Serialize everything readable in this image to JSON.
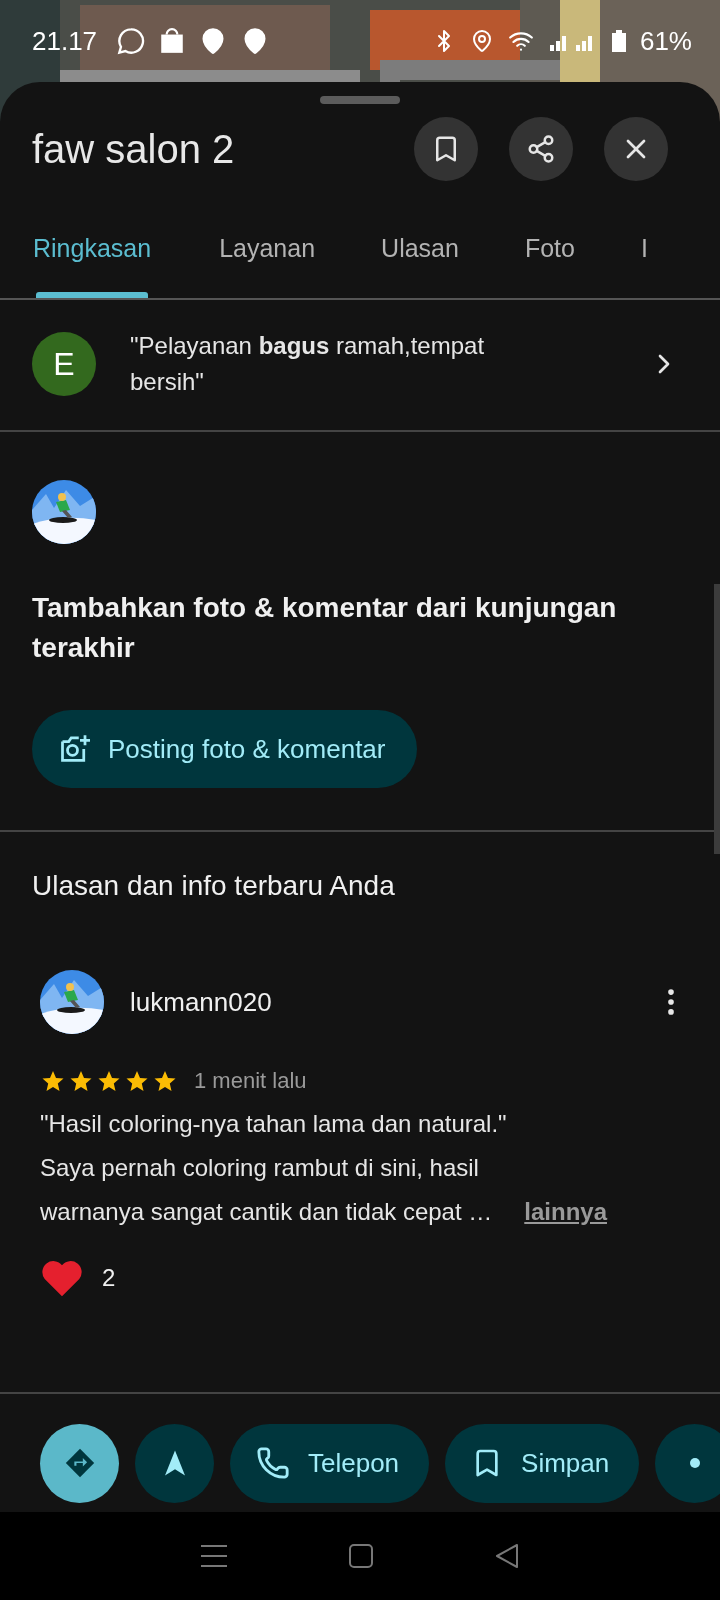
{
  "status_bar": {
    "time": "21.17",
    "battery": "61%"
  },
  "sheet": {
    "title": "faw salon 2"
  },
  "tabs": [
    {
      "label": "Ringkasan",
      "selected": true
    },
    {
      "label": "Layanan",
      "selected": false
    },
    {
      "label": "Ulasan",
      "selected": false
    },
    {
      "label": "Foto",
      "selected": false
    },
    {
      "label": "I",
      "selected": false
    }
  ],
  "highlights": [
    {
      "initial": "E",
      "color": "#33691e",
      "text": "\"Pelayanan **bagus** ramah,tempat\nbersih\""
    }
  ],
  "add_review": {
    "heading": "Tambahkan foto & komentar dari kunjungan terakhir",
    "button": "Posting foto & komentar"
  },
  "your_reviews": {
    "heading": "Ulasan dan info terbaru Anda",
    "reviews": [
      {
        "author": "lukmann020",
        "stars": 5,
        "time": "1 menit lalu",
        "text": "\"Hasil coloring-nya tahan lama dan natural.\"\nSaya pernah coloring rambut di sini, hasil\nwarnanya sangat cantik dan tidak cepat …",
        "more_link": "lainnya",
        "likes": "2"
      }
    ]
  },
  "actions": [
    {
      "kind": "directions"
    },
    {
      "kind": "start"
    },
    {
      "kind": "call",
      "label": "Telepon"
    },
    {
      "kind": "save",
      "label": "Simpan"
    },
    {
      "kind": "more"
    }
  ]
}
